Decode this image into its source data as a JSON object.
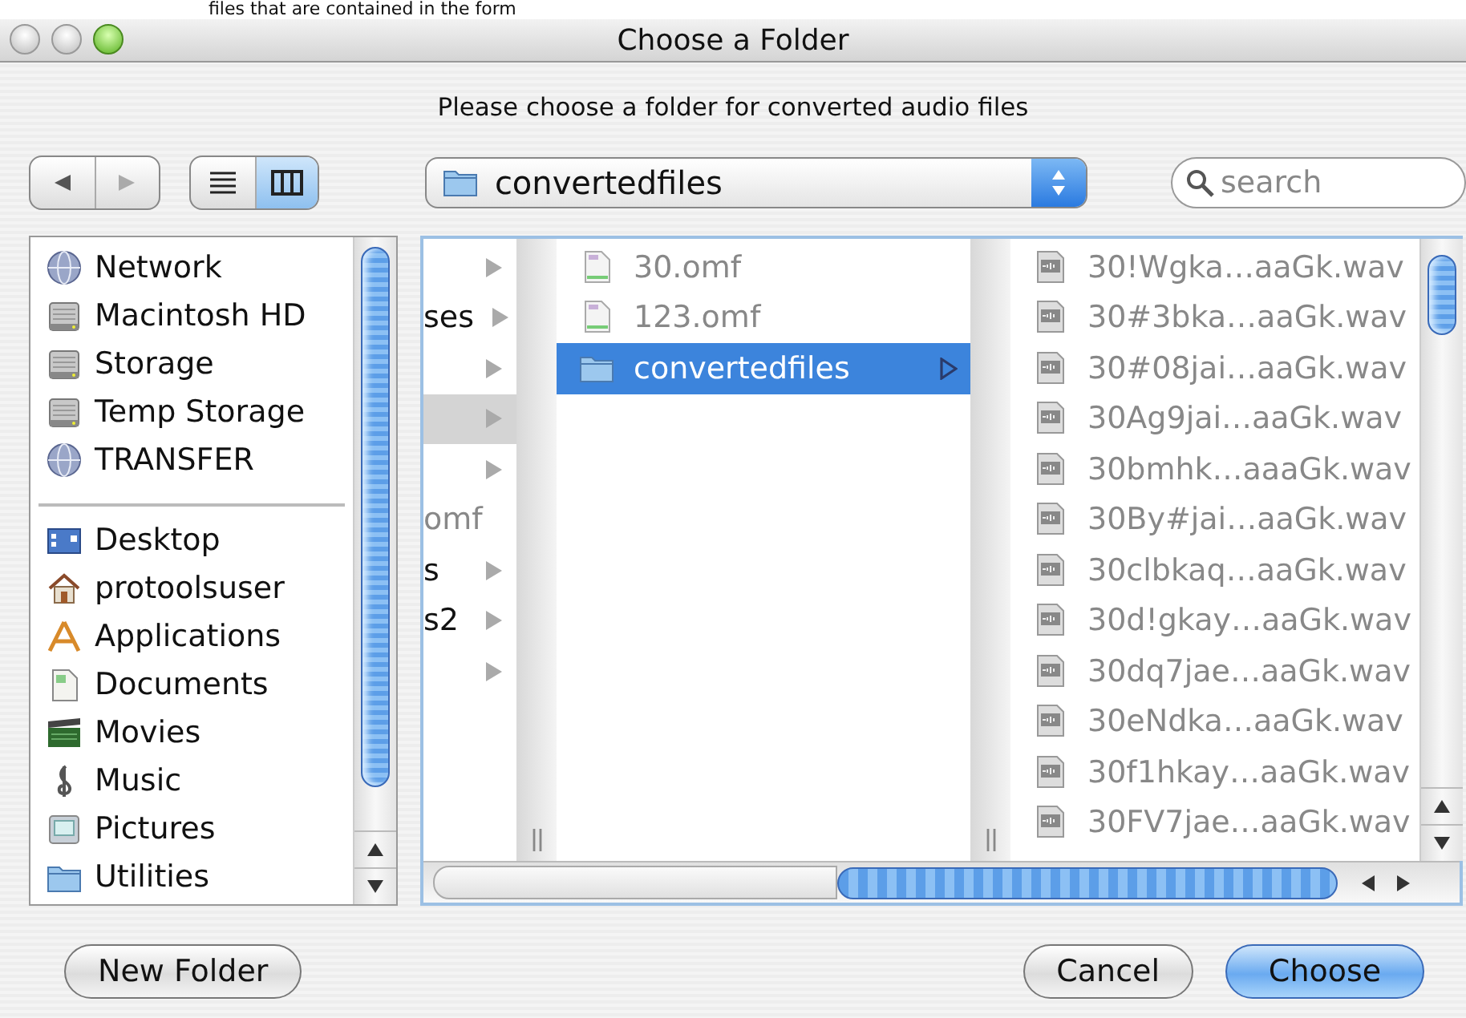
{
  "backdrop_text": "files that are contained in the form",
  "window": {
    "title": "Choose a Folder"
  },
  "prompt": "Please choose a folder for converted audio files",
  "toolbar": {
    "view_modes": [
      {
        "kind": "list",
        "selected": false
      },
      {
        "kind": "columns",
        "selected": true
      }
    ],
    "location": "convertedfiles",
    "search": {
      "placeholder": "search"
    }
  },
  "sidebar": {
    "sections": [
      {
        "items": [
          {
            "label": "Network",
            "kind": "network"
          },
          {
            "label": "Macintosh HD",
            "kind": "disk"
          },
          {
            "label": "Storage",
            "kind": "disk"
          },
          {
            "label": "Temp Storage",
            "kind": "disk"
          },
          {
            "label": "TRANSFER",
            "kind": "network"
          }
        ]
      },
      {
        "items": [
          {
            "label": "Desktop",
            "kind": "desktop"
          },
          {
            "label": "protoolsuser",
            "kind": "home"
          },
          {
            "label": "Applications",
            "kind": "applications"
          },
          {
            "label": "Documents",
            "kind": "documents"
          },
          {
            "label": "Movies",
            "kind": "movies"
          },
          {
            "label": "Music",
            "kind": "music"
          },
          {
            "label": "Pictures",
            "kind": "pictures"
          },
          {
            "label": "Utilities",
            "kind": "folder"
          }
        ]
      }
    ]
  },
  "columns": [
    {
      "rows": [
        {
          "kind": "folder",
          "selected": false
        },
        {
          "kind": "folder",
          "label": "ses",
          "selected": false
        },
        {
          "kind": "folder",
          "selected": false
        },
        {
          "kind": "folder",
          "selected": true
        },
        {
          "kind": "folder",
          "selected": false
        },
        {
          "kind": "file",
          "label": "omf",
          "selected": false
        },
        {
          "kind": "folder",
          "label": "s",
          "selected": false
        },
        {
          "kind": "folder",
          "label": "s2",
          "selected": false
        },
        {
          "kind": "folder",
          "selected": false
        }
      ]
    },
    {
      "rows": [
        {
          "kind": "file",
          "label": "30.omf",
          "selected": false
        },
        {
          "kind": "file",
          "label": "123.omf",
          "selected": false
        },
        {
          "kind": "folder",
          "label": "convertedfiles",
          "selected": true
        }
      ]
    },
    {
      "rows": [
        {
          "kind": "audio",
          "label": "30!Wgka…aaGk.wav",
          "selected": false
        },
        {
          "kind": "audio",
          "label": "30#3bka…aaGk.wav",
          "selected": false
        },
        {
          "kind": "audio",
          "label": "30#08jai…aaGk.wav",
          "selected": false
        },
        {
          "kind": "audio",
          "label": "30Ag9jai…aaGk.wav",
          "selected": false
        },
        {
          "kind": "audio",
          "label": "30bmhk…aaaGk.wav",
          "selected": false
        },
        {
          "kind": "audio",
          "label": "30By#jai…aaGk.wav",
          "selected": false
        },
        {
          "kind": "audio",
          "label": "30clbkaq…aaGk.wav",
          "selected": false
        },
        {
          "kind": "audio",
          "label": "30d!gkay…aaGk.wav",
          "selected": false
        },
        {
          "kind": "audio",
          "label": "30dq7jae…aaGk.wav",
          "selected": false
        },
        {
          "kind": "audio",
          "label": "30eNdka…aaGk.wav",
          "selected": false
        },
        {
          "kind": "audio",
          "label": "30f1hkay…aaGk.wav",
          "selected": false
        },
        {
          "kind": "audio",
          "label": "30FV7jae…aaGk.wav",
          "selected": false
        }
      ]
    }
  ],
  "buttons": [
    {
      "label": "New Folder",
      "kind": "secondary"
    },
    {
      "label": "Cancel",
      "kind": "secondary"
    },
    {
      "label": "Choose",
      "kind": "default"
    }
  ]
}
